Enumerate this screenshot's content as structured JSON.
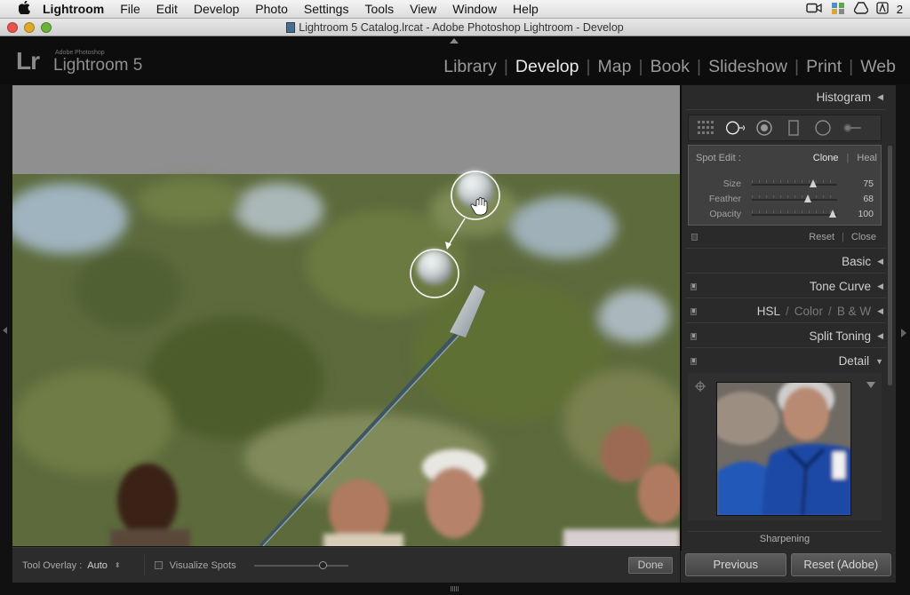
{
  "menubar": {
    "app_name": "Lightroom",
    "items": [
      "File",
      "Edit",
      "Develop",
      "Photo",
      "Settings",
      "Tools",
      "View",
      "Window",
      "Help"
    ],
    "status_number": "2"
  },
  "window": {
    "title": "Lightroom 5 Catalog.lrcat - Adobe Photoshop Lightroom - Develop"
  },
  "identity": {
    "logo": "Lr",
    "brand_small": "Adobe Photoshop",
    "product": "Lightroom 5"
  },
  "modules": [
    "Library",
    "Develop",
    "Map",
    "Book",
    "Slideshow",
    "Print",
    "Web"
  ],
  "toolbar": {
    "overlay_label": "Tool Overlay :",
    "overlay_value": "Auto",
    "visualize_label": "Visualize Spots",
    "visualize_checked": false,
    "visualize_level": 0.74,
    "done_label": "Done"
  },
  "panel": {
    "histogram_label": "Histogram",
    "spot_edit": {
      "label": "Spot Edit :",
      "clone_label": "Clone",
      "heal_label": "Heal",
      "sliders": [
        {
          "name": "Size",
          "value": "75",
          "level": 0.72
        },
        {
          "name": "Feather",
          "value": "68",
          "level": 0.66
        },
        {
          "name": "Opacity",
          "value": "100",
          "level": 0.95
        }
      ]
    },
    "reset_label": "Reset",
    "close_label": "Close",
    "sections": {
      "basic": "Basic",
      "tone_curve": "Tone Curve",
      "hsl": "HSL",
      "color": "Color",
      "bw": "B & W",
      "split_toning": "Split Toning",
      "detail": "Detail"
    },
    "sharpening_label": "Sharpening"
  },
  "bottom_buttons": {
    "previous": "Previous",
    "reset": "Reset (Adobe)"
  },
  "colors": {
    "panel_bg": "#2a2a2a",
    "active_module": "#e9e9e9",
    "inactive_module": "#9a9a9a"
  }
}
